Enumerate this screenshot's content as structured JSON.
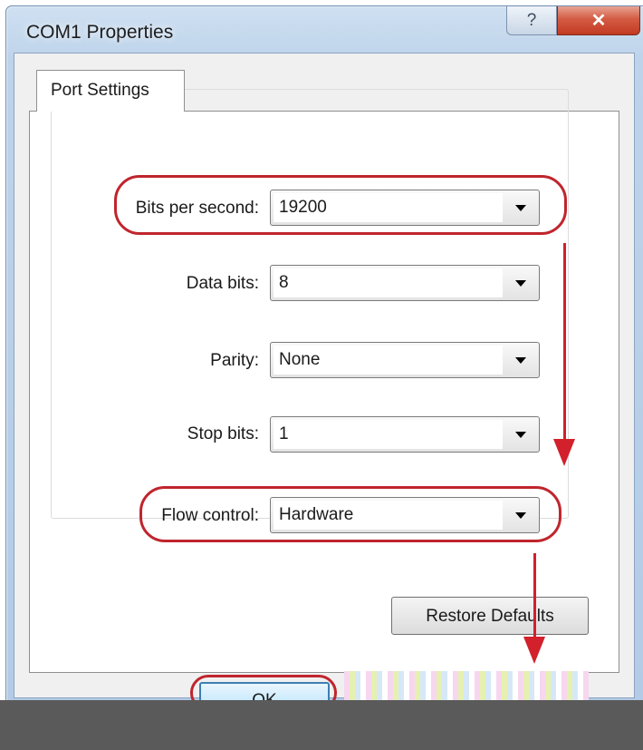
{
  "window": {
    "title": "COM1 Properties",
    "help_glyph": "?",
    "close_glyph": "✕"
  },
  "tabs": [
    {
      "label": "Port Settings",
      "selected": true
    }
  ],
  "settings": {
    "bits_per_second": {
      "label": "Bits per second:",
      "value": "19200"
    },
    "data_bits": {
      "label": "Data bits:",
      "value": "8"
    },
    "parity": {
      "label": "Parity:",
      "value": "None"
    },
    "stop_bits": {
      "label": "Stop bits:",
      "value": "1"
    },
    "flow_control": {
      "label": "Flow control:",
      "value": "Hardware"
    }
  },
  "buttons": {
    "restore_defaults": "Restore Defaults",
    "ok": "OK"
  },
  "annotations": {
    "highlight_color": "#d2202c"
  }
}
